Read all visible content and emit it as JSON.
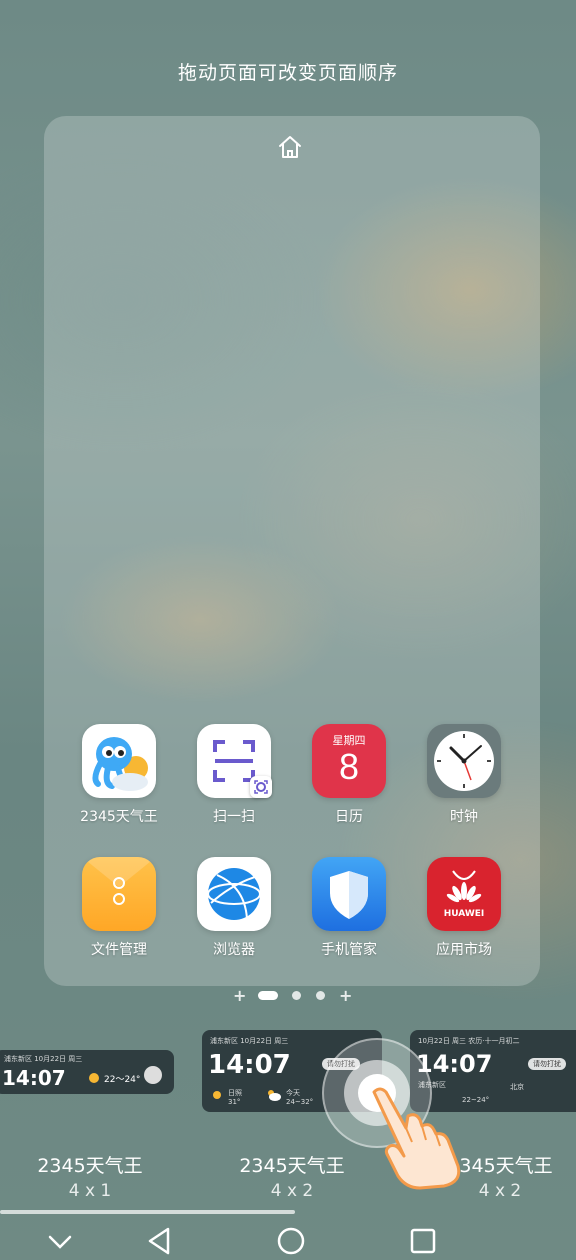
{
  "hint": "拖动页面可改变页面顺序",
  "apps": [
    {
      "label": "2345天气王",
      "icon": "weather-octopus-icon"
    },
    {
      "label": "扫一扫",
      "icon": "scan-icon"
    },
    {
      "label": "日历",
      "icon": "calendar-icon",
      "weekday": "星期四",
      "day": "8"
    },
    {
      "label": "时钟",
      "icon": "clock-icon"
    },
    {
      "label": "文件管理",
      "icon": "folder-icon"
    },
    {
      "label": "浏览器",
      "icon": "browser-globe-icon"
    },
    {
      "label": "手机管家",
      "icon": "shield-icon"
    },
    {
      "label": "应用市场",
      "icon": "huawei-appgallery-icon",
      "brand": "HUAWEI"
    }
  ],
  "widgets": [
    {
      "name": "2345天气王",
      "size": "4 x 1",
      "time": "14:07",
      "temp": "22～24°",
      "location": "浦东新区 10月22日 周三"
    },
    {
      "name": "2345天气王",
      "size": "4 x 2",
      "time": "14:07",
      "location": "浦东新区 10月22日 周三",
      "pill": "请勿打扰",
      "today_label": "今天",
      "today_temp": "24~32°",
      "left_label": "日照",
      "left_temp": "31°"
    },
    {
      "name": "2345天气王",
      "size": "4 x 2",
      "time": "14:07",
      "location": "浦东新区",
      "date": "10月22日 周三 农历·十一月初二",
      "temp": "22~24°",
      "right_label": "北京",
      "pill": "请勿打扰"
    }
  ],
  "colors": {
    "accent": "#ffffff",
    "card": "rgba(255,255,255,0.22)",
    "widget_bg": "#1e282d"
  }
}
